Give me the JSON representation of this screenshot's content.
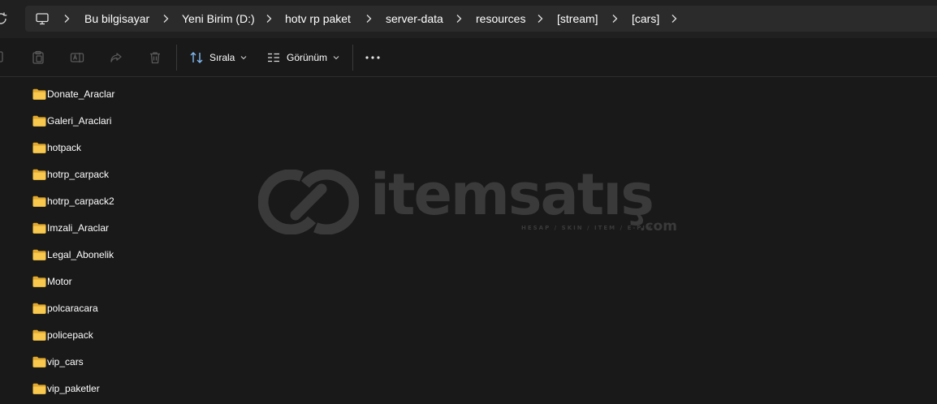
{
  "address_bar": {
    "crumbs": [
      {
        "label": "Bu bilgisayar"
      },
      {
        "label": "Yeni Birim (D:)"
      },
      {
        "label": "hotv rp paket"
      },
      {
        "label": "server-data"
      },
      {
        "label": "resources"
      },
      {
        "label": "[stream]"
      },
      {
        "label": "[cars]"
      }
    ]
  },
  "toolbar": {
    "sort_label": "Sırala",
    "view_label": "Görünüm",
    "icons": [
      "copy-icon",
      "paste-icon",
      "rename-icon",
      "share-icon",
      "delete-icon",
      "sort-icon",
      "view-icon",
      "more-icon"
    ]
  },
  "folders": [
    {
      "name": "Donate_Araclar"
    },
    {
      "name": "Galeri_Araclari"
    },
    {
      "name": "hotpack"
    },
    {
      "name": "hotrp_carpack"
    },
    {
      "name": "hotrp_carpack2"
    },
    {
      "name": "Imzali_Araclar"
    },
    {
      "name": "Legal_Abonelik"
    },
    {
      "name": "Motor"
    },
    {
      "name": "polcaracara"
    },
    {
      "name": "policepack"
    },
    {
      "name": "vip_cars"
    },
    {
      "name": "vip_paketler"
    }
  ],
  "watermark": {
    "word": "itemsatış",
    "domain": ".com",
    "tagline": "HESAP / SKIN / ITEM / E-PIN"
  },
  "colors": {
    "background": "#191919",
    "address_bar": "#2b2b2b",
    "folder_yellow": "#f2c14e",
    "watermark": "#3a3a3a"
  }
}
